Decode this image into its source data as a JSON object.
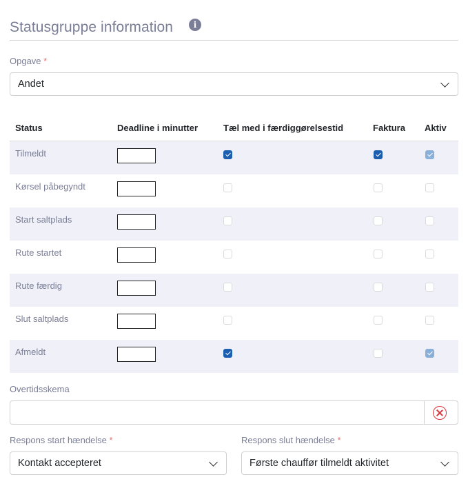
{
  "header": {
    "title": "Statusgruppe information",
    "info_icon": "i"
  },
  "task": {
    "label": "Opgave",
    "required_mark": "*",
    "value": "Andet"
  },
  "table": {
    "headers": [
      "Status",
      "Deadline i minutter",
      "Tæl med i færdiggørelsestid",
      "Faktura",
      "Aktiv"
    ],
    "rows": [
      {
        "status": "Tilmeldt",
        "deadline": "",
        "count": true,
        "invoice": true,
        "active": true
      },
      {
        "status": "Kørsel påbegyndt",
        "deadline": "",
        "count": false,
        "invoice": false,
        "active": false
      },
      {
        "status": "Start saltplads",
        "deadline": "",
        "count": false,
        "invoice": false,
        "active": false
      },
      {
        "status": "Rute startet",
        "deadline": "",
        "count": false,
        "invoice": false,
        "active": false
      },
      {
        "status": "Rute færdig",
        "deadline": "",
        "count": false,
        "invoice": false,
        "active": false
      },
      {
        "status": "Slut saltplads",
        "deadline": "",
        "count": false,
        "invoice": false,
        "active": false
      },
      {
        "status": "Afmeldt",
        "deadline": "",
        "count": true,
        "invoice": false,
        "active": true
      }
    ]
  },
  "overtime": {
    "label": "Overtidsskema",
    "value": "",
    "clear_icon": "close-circle-icon"
  },
  "response_start": {
    "label": "Respons start hændelse",
    "required_mark": "*",
    "value": "Kontakt accepteret"
  },
  "response_end": {
    "label": "Respons slut hændelse",
    "required_mark": "*",
    "value": "Første chauffør tilmeldt aktivitet"
  },
  "colors": {
    "accent": "#1c5fb0",
    "active_disabled": "#8ab0da",
    "stripe": "#f0f1f8",
    "muted_text": "#7a7e96",
    "required": "#e57373",
    "danger": "#d9363e"
  }
}
